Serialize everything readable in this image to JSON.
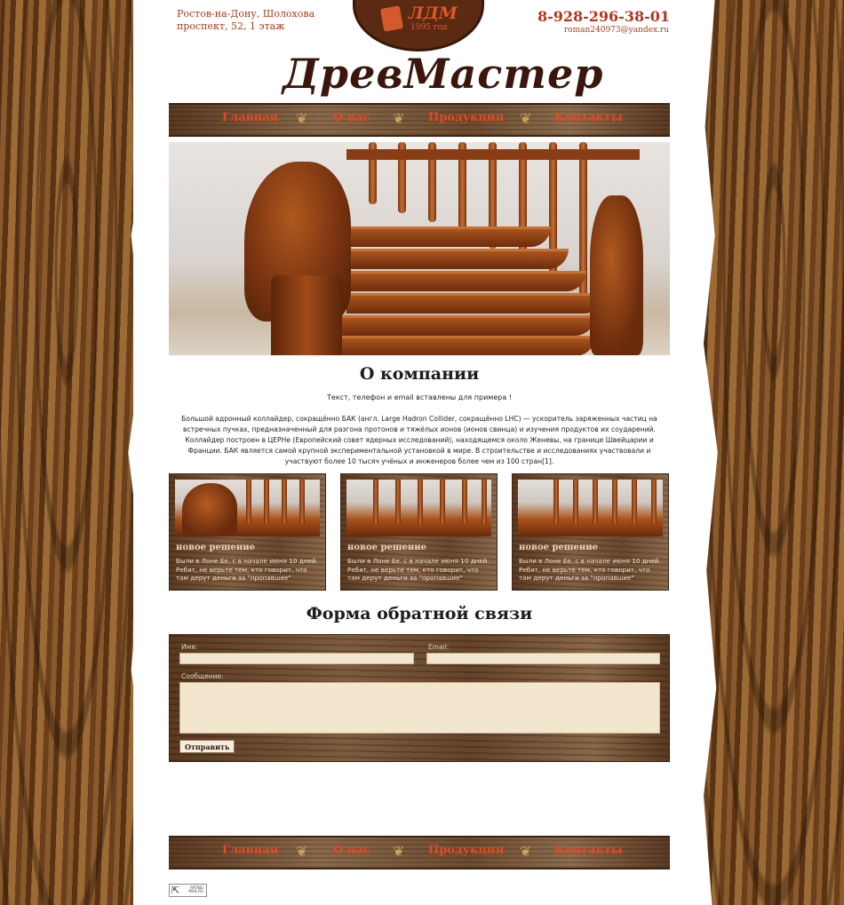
{
  "header": {
    "address_line1": "Ростов-на-Дону, Шолохова",
    "address_line2": "проспект, 52, 1 этаж",
    "logo_text": "ЛДМ",
    "logo_year": "1995 год",
    "phone": "8-928-296-38-01",
    "email": "roman240973@yandex.ru",
    "site_title": "ДревМастер"
  },
  "nav": {
    "items": [
      "Главная",
      "О нас",
      "Продукция",
      "Контакты"
    ]
  },
  "about": {
    "title": "О компании",
    "note": "Текст, телефон и email вставлены для примера !",
    "text": "Большой адронный коллайдер, сокращённо БАК (англ. Large Hadron Collider, сокращённо LHC) — ускоритель заряженных частиц на встречных пучках, предназначенный для разгона протонов и тяжёлых ионов (ионов свинца) и изучения продуктов их соударений. Коллайдер построен в ЦЕРНе (Европейский совет ядерных исследований), находящемся около Женевы, на границе Швейцарии и Франции. БАК является самой крупной экспериментальной установкой в мире. В строительстве и исследованиях участвовали и участвуют более 10 тысяч учёных и инженеров более чем из 100 стран[1]."
  },
  "cards": [
    {
      "title": "новое решение",
      "text": "Были в Лоне Ee. c в начале июня 10 дней. Ребят, не верьте тем, кто говорит, что там дерут деньги за \"пропавшие\""
    },
    {
      "title": "новое решение",
      "text": "Были в Лоне Ee. c в начале июня 10 дней. Ребят, не верьте тем, кто говорит, что там дерут деньги за \"пропавшие\""
    },
    {
      "title": "новое решение",
      "text": "Были в Лоне Ee. c в начале июня 10 дней. Ребят, не верьте тем, кто говорит, что там дерут деньги за \"пропавшие\""
    }
  ],
  "form": {
    "title": "Форма обратной связи",
    "name_label": "Имя:",
    "email_label": "Email:",
    "message_label": "Сообщение:",
    "name_value": "",
    "email_value": "",
    "message_value": "",
    "submit_label": "Отправить"
  },
  "counter": {
    "line1": "RATING",
    "line2": "MAIL.RU"
  },
  "colors": {
    "accent": "#e24a22",
    "title_brown": "#3b160c",
    "address_red": "#a83a1d"
  }
}
